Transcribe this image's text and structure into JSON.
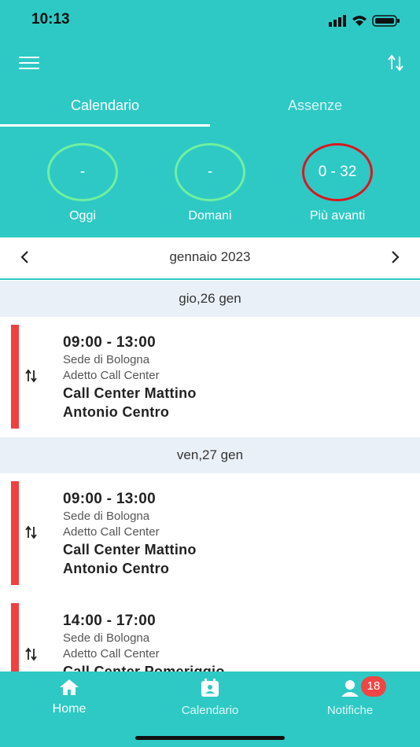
{
  "status": {
    "time": "10:13"
  },
  "tabs": [
    {
      "label": "Calendario"
    },
    {
      "label": "Assenze"
    }
  ],
  "counters": [
    {
      "value": "-",
      "label": "Oggi"
    },
    {
      "value": "-",
      "label": "Domani"
    },
    {
      "value": "0 - 32",
      "label": "Più avanti"
    }
  ],
  "month_nav": {
    "label": "gennaio 2023"
  },
  "days": [
    {
      "header": "gio,26 gen",
      "shifts": [
        {
          "time": "09:00 -  13:00",
          "location": "Sede di Bologna",
          "role": "Adetto Call Center",
          "title": "Call Center Mattino",
          "person": "Antonio Centro"
        }
      ]
    },
    {
      "header": "ven,27 gen",
      "shifts": [
        {
          "time": "09:00 -  13:00",
          "location": "Sede di Bologna",
          "role": "Adetto Call Center",
          "title": "Call Center Mattino",
          "person": "Antonio Centro"
        },
        {
          "time": "14:00 -  17:00",
          "location": "Sede di Bologna",
          "role": "Adetto Call Center",
          "title": "Call Center Pomeriggio",
          "person": ""
        }
      ]
    }
  ],
  "bottom_nav": {
    "home": "Home",
    "calendar": "Calendario",
    "notifications": "Notifiche",
    "notifications_badge": "18"
  },
  "colors": {
    "accent": "#2ec9c4",
    "shift_bar": "#f04040",
    "ring_ok": "#6ff0a0",
    "ring_alert": "#d81820"
  }
}
